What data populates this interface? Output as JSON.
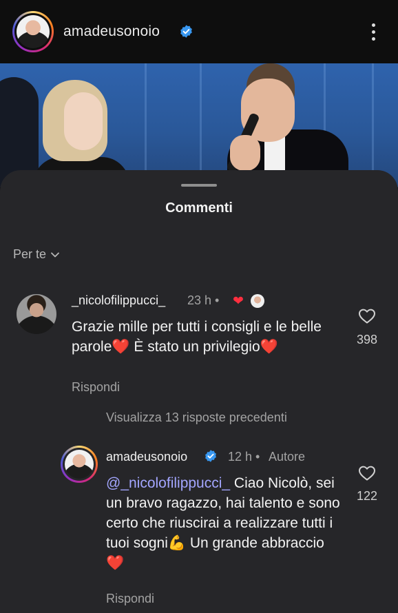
{
  "header": {
    "username": "amadeusonoio",
    "verified_color": "#3897f0"
  },
  "sheet": {
    "title": "Commenti",
    "filter_label": "Per te"
  },
  "comments": [
    {
      "username": "_nicolofilippucci_",
      "time": "23 h •",
      "text": "Grazie mille per tutti i consigli e le belle parole❤️ È stato un privilegio❤️",
      "reply_label": "Rispondi",
      "likes": "398",
      "liked_by_author_icon": "red-heart-icon"
    }
  ],
  "view_replies_label": "Visualizza 13 risposte precedenti",
  "reply": {
    "username": "amadeusonoio",
    "time": "12 h •",
    "author_badge": "Autore",
    "mention": "@_nicolofilippucci_",
    "text": " Ciao Nicolò, sei un bravo ragazzo, hai talento e sono certo che riuscirai a realizzare tutti i tuoi sogni💪 Un grande abbraccio ❤️",
    "reply_label": "Rispondi",
    "likes": "122"
  }
}
